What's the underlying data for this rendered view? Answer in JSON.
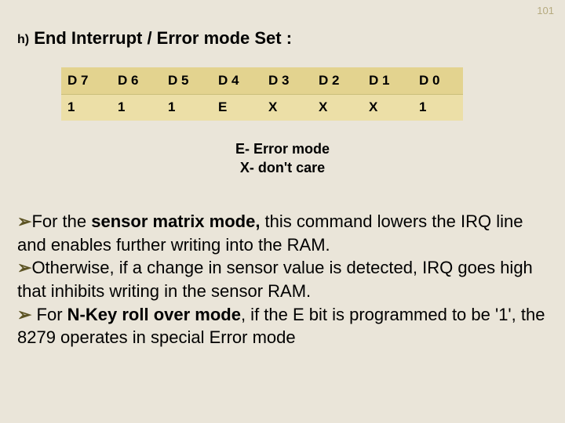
{
  "page_number": "101",
  "heading": {
    "letter": "h)",
    "title": "End Interrupt / Error mode Set :"
  },
  "table": {
    "headers": [
      "D 7",
      "D 6",
      "D 5",
      "D 4",
      "D 3",
      "D 2",
      "D 1",
      "D 0"
    ],
    "row": [
      "1",
      "1",
      "1",
      "E",
      "X",
      "X",
      "X",
      "1"
    ]
  },
  "legend": {
    "line1": "E- Error mode",
    "line2": "X- don't care"
  },
  "bullets": [
    {
      "pre": "For the ",
      "bold": "sensor matrix mode,",
      "post": " this command lowers the IRQ line and enables further writing into the RAM."
    },
    {
      "pre": "Otherwise, if a change in sensor value is detected, IRQ goes high that inhibits writing in the sensor RAM.",
      "bold": "",
      "post": ""
    },
    {
      "pre": " For ",
      "bold": "N-Key roll over mode",
      "post": ", if the E bit is programmed to be '1', the 8279 operates in special Error mode"
    }
  ],
  "chevron": "➢"
}
